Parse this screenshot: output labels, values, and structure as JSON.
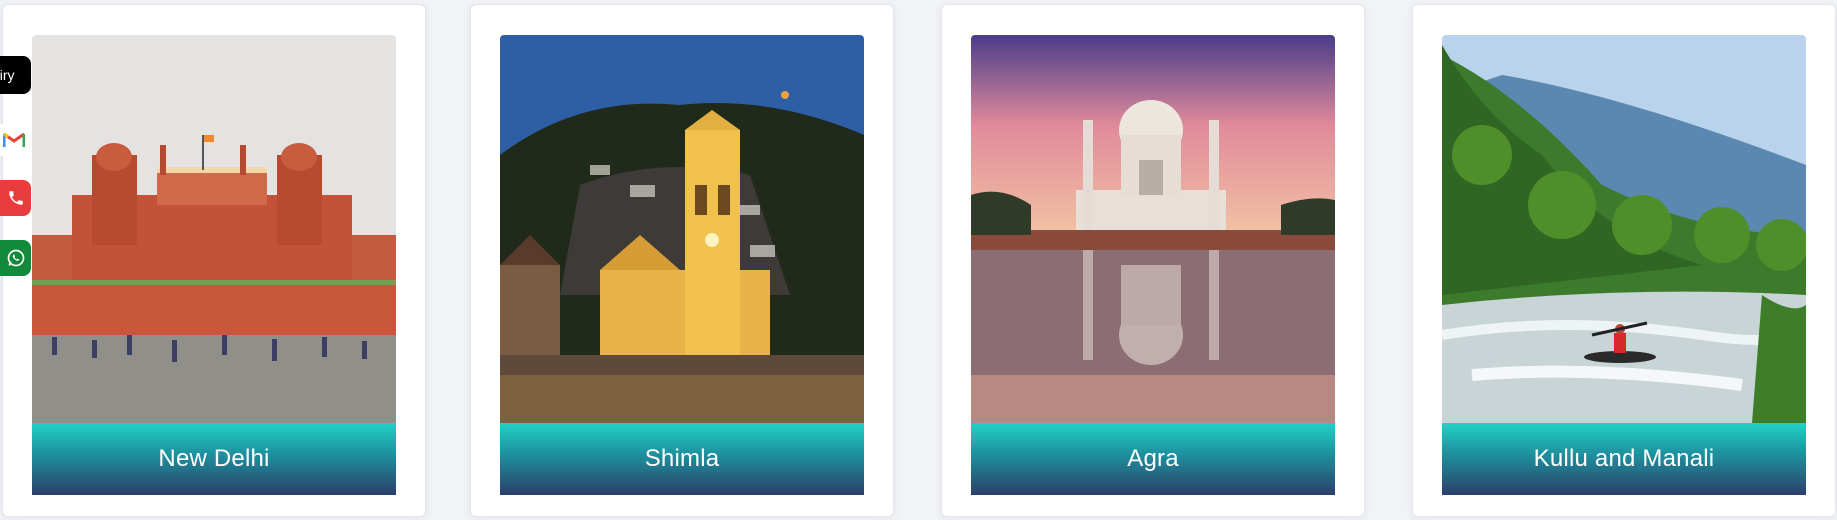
{
  "side_buttons": {
    "enquiry_label": "uiry",
    "mail_icon": "gmail-icon",
    "call_icon": "phone-icon",
    "whatsapp_icon": "whatsapp-icon"
  },
  "destinations": [
    {
      "name": "New Delhi"
    },
    {
      "name": "Shimla"
    },
    {
      "name": "Agra"
    },
    {
      "name": "Kullu and Manali"
    }
  ],
  "colors": {
    "label_gradient_top": "#21d1c8",
    "label_gradient_bottom": "#2a3f6a",
    "call": "#ea3c3c",
    "whatsapp": "#128a3b"
  }
}
